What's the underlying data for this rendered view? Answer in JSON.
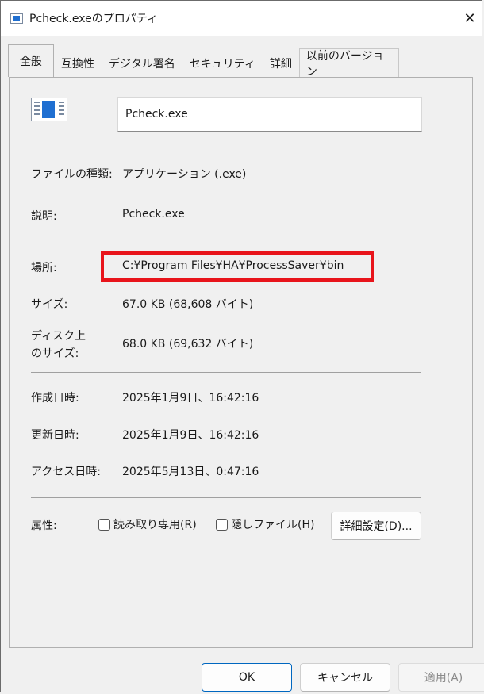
{
  "window": {
    "title": "Pcheck.exeのプロパティ",
    "close_glyph": "✕"
  },
  "tabs": [
    "全般",
    "互換性",
    "デジタル署名",
    "セキュリティ",
    "詳細",
    "以前のバージョン"
  ],
  "general": {
    "file_name": "Pcheck.exe",
    "file_type_label": "ファイルの種類:",
    "file_type_value": "アプリケーション (.exe)",
    "description_label": "説明:",
    "description_value": "Pcheck.exe",
    "location_label": "場所:",
    "location_value": "C:¥Program Files¥HA¥ProcessSaver¥bin",
    "size_label": "サイズ:",
    "size_value": "67.0 KB (68,608 バイト)",
    "disk_size_label_line1": "ディスク上",
    "disk_size_label_line2": "のサイズ:",
    "disk_size_value": "68.0 KB (69,632 バイト)",
    "created_label": "作成日時:",
    "created_value": "2025年1月9日、16:42:16",
    "modified_label": "更新日時:",
    "modified_value": "2025年1月9日、16:42:16",
    "accessed_label": "アクセス日時:",
    "accessed_value": "2025年5月13日、0:47:16",
    "attributes_label": "属性:",
    "readonly_label": "読み取り専用(R)",
    "readonly_checked": false,
    "hidden_label": "隠しファイル(H)",
    "hidden_checked": false,
    "advanced_button": "詳細設定(D)..."
  },
  "footer": {
    "ok": "OK",
    "cancel": "キャンセル",
    "apply": "適用(A)"
  },
  "colors": {
    "highlight": "#e8141b",
    "accent": "#0067c0"
  },
  "icons": {
    "title": "exe-file-icon",
    "file": "exe-file-icon",
    "close": "close-icon"
  }
}
